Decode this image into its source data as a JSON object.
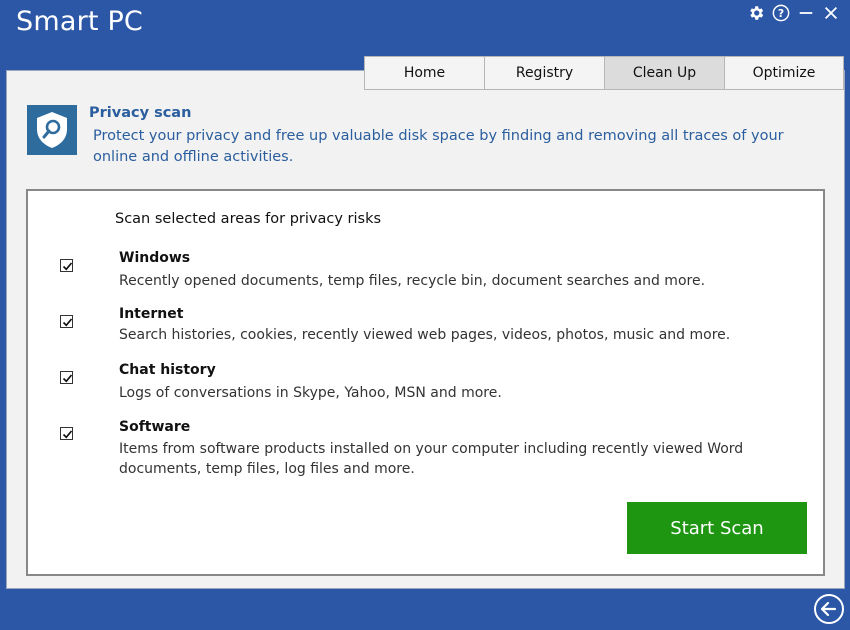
{
  "app": {
    "title": "Smart PC"
  },
  "window_controls": [
    {
      "name": "settings",
      "icon": "gear-icon"
    },
    {
      "name": "help",
      "icon": "help-icon"
    },
    {
      "name": "minimize",
      "icon": "minimize-icon"
    },
    {
      "name": "close",
      "icon": "close-icon"
    }
  ],
  "tabs": [
    {
      "label": "Home",
      "active": false
    },
    {
      "label": "Registry",
      "active": false
    },
    {
      "label": "Clean Up",
      "active": true
    },
    {
      "label": "Optimize",
      "active": false
    }
  ],
  "header": {
    "title": "Privacy scan",
    "description": "Protect your privacy and free up valuable disk space by finding and removing all traces of your online and offline activities."
  },
  "scan": {
    "title": "Scan selected areas for privacy risks",
    "items": [
      {
        "name": "Windows",
        "description": "Recently opened documents, temp files, recycle bin, document searches and more.",
        "checked": true
      },
      {
        "name": "Internet",
        "description": "Search histories, cookies, recently viewed web pages, videos, photos, music and more.",
        "checked": true
      },
      {
        "name": "Chat history",
        "description": "Logs of conversations in Skype, Yahoo, MSN and more.",
        "checked": true
      },
      {
        "name": "Software",
        "description": "Items from software products installed on your computer including recently viewed Word documents, temp files, log files and more.",
        "checked": true
      }
    ],
    "start_label": "Start Scan"
  },
  "colors": {
    "background": "#2b57a6",
    "accent_text": "#2a5e9e",
    "start_button": "#1f9612"
  }
}
